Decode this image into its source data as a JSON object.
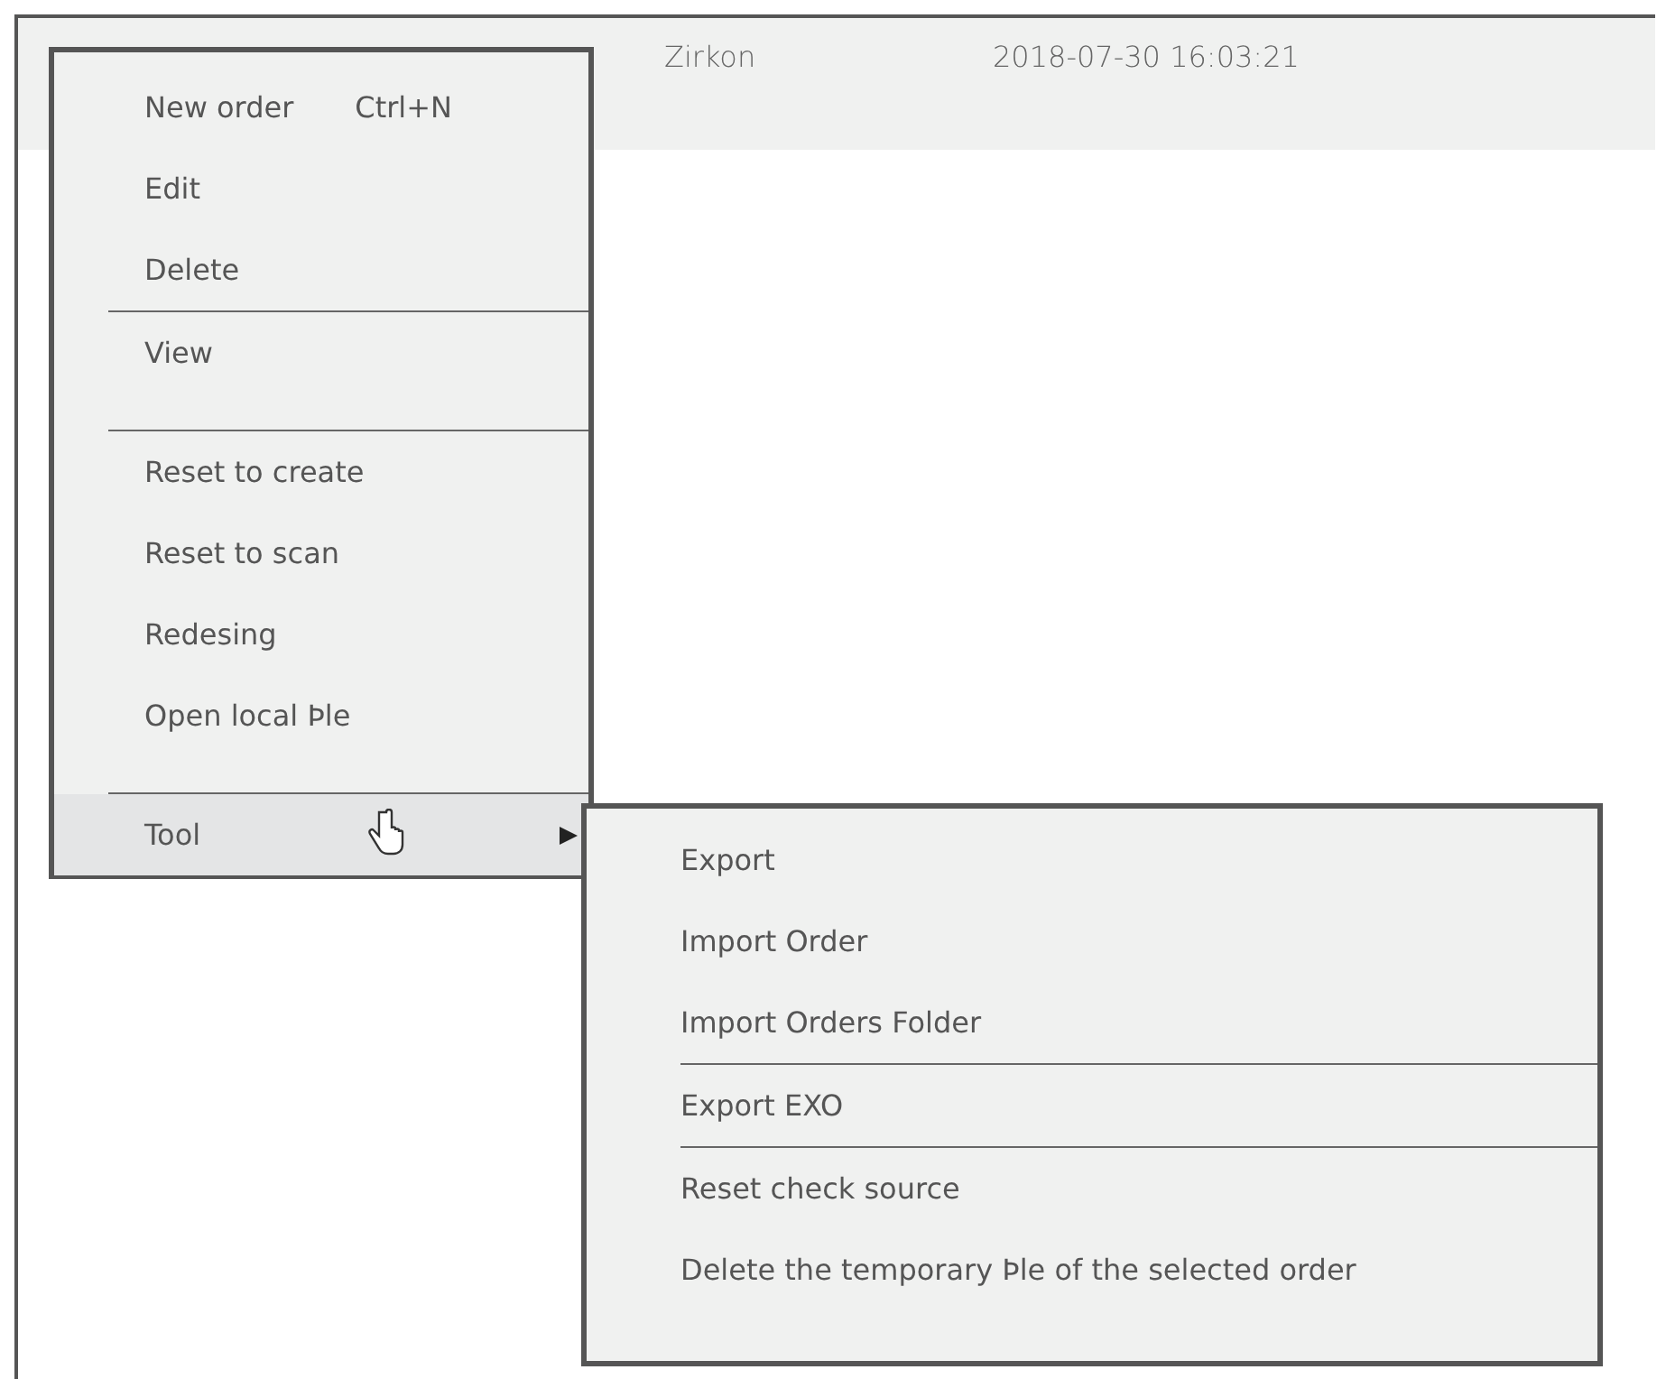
{
  "table": {
    "rows": [
      {
        "cells": [
          "Zirkon",
          "2018-07-30 16:03:21"
        ]
      }
    ]
  },
  "context_menu": {
    "items": [
      {
        "kind": "item",
        "label": "New order",
        "shortcut": "Ctrl+N",
        "highlighted": false
      },
      {
        "kind": "item",
        "label": "Edit",
        "highlighted": false
      },
      {
        "kind": "item",
        "label": "Delete",
        "highlighted": false
      },
      {
        "kind": "separator"
      },
      {
        "kind": "item",
        "label": "View",
        "highlighted": false
      },
      {
        "kind": "spacer"
      },
      {
        "kind": "separator"
      },
      {
        "kind": "item",
        "label": "Reset to create",
        "highlighted": false
      },
      {
        "kind": "item",
        "label": "Reset to scan",
        "highlighted": false
      },
      {
        "kind": "item",
        "label": "Redesing",
        "highlighted": false
      },
      {
        "kind": "item",
        "label": "Open local Þle",
        "highlighted": false
      },
      {
        "kind": "spacer"
      },
      {
        "kind": "separator"
      },
      {
        "kind": "item",
        "label": "Tool",
        "highlighted": true,
        "submenu": true
      }
    ]
  },
  "submenu": {
    "items": [
      {
        "kind": "item",
        "label": "Export"
      },
      {
        "kind": "item",
        "label": "Import Order"
      },
      {
        "kind": "item",
        "label": "Import Orders Folder"
      },
      {
        "kind": "separator"
      },
      {
        "kind": "item",
        "label": "Export EXO"
      },
      {
        "kind": "separator"
      },
      {
        "kind": "item",
        "label": "Reset check source"
      },
      {
        "kind": "item",
        "label": "Delete the temporary Þle of the selected order"
      }
    ]
  }
}
